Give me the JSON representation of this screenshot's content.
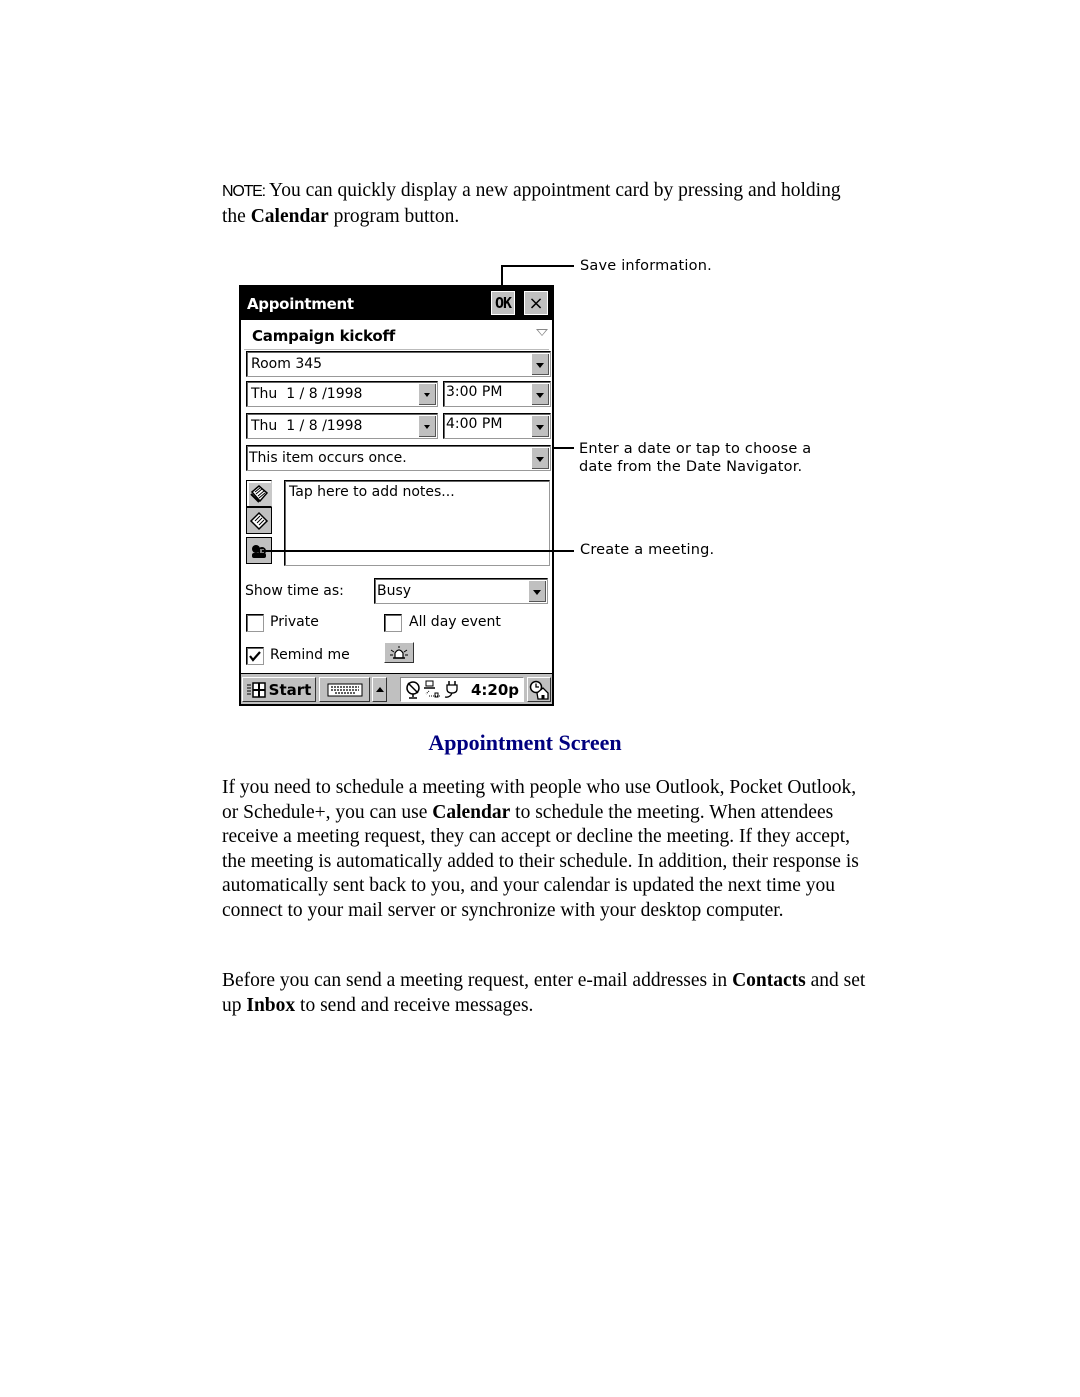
{
  "note": {
    "label": "NOTE:",
    "text_before": " You can quickly display a new appointment card by pressing and holding the ",
    "bold": "Calendar",
    "text_after": " program button."
  },
  "appointment": {
    "title": "Appointment",
    "ok_label": "OK",
    "close_label": "×",
    "subject": "Campaign kickoff",
    "location": "Room 345",
    "start_date": "Thu  1 / 8 /1998",
    "start_time": "3:00 PM",
    "end_date": "Thu  1 / 8 /1998",
    "end_time": "4:00 PM",
    "recurrence": "This item occurs once.",
    "notes_placeholder": "Tap here to add notes...",
    "show_time_label": "Show time as:",
    "show_time_value": "Busy",
    "private_label": "Private",
    "private_checked": false,
    "all_day_label": "All day event",
    "all_day_checked": false,
    "remind_label": "Remind me",
    "remind_checked": true,
    "side_tabs": [
      "notes-icon",
      "categories-icon",
      "attendees-icon"
    ]
  },
  "taskbar": {
    "start_label": "Start",
    "clock": "4:20p",
    "tray_icons": [
      "sync-icon",
      "network-icon",
      "power-plug-icon"
    ]
  },
  "callouts": {
    "save": "Save information.",
    "date": [
      "Enter a date or tap to choose a",
      "date from the Date Navigator."
    ],
    "meeting": "Create a meeting."
  },
  "caption": "Appointment Screen",
  "para1": {
    "a": "If you need to schedule a meeting with people who use Outlook, Pocket Outlook, or Schedule+, you can use ",
    "b": "Calendar",
    "c": " to schedule the meeting. When attendees receive a meeting request, they can accept or decline the meeting. If they accept, the meeting is automatically added to their schedule. In addition, their response is automatically sent back to you, and your calendar is updated the next time you connect to your mail server or synchronize with your desktop computer."
  },
  "para2": {
    "a": "Before you can send a meeting request, enter e-mail addresses in ",
    "b": "Contacts",
    "c": " and set up ",
    "d": "Inbox",
    "e": " to send and receive messages."
  }
}
